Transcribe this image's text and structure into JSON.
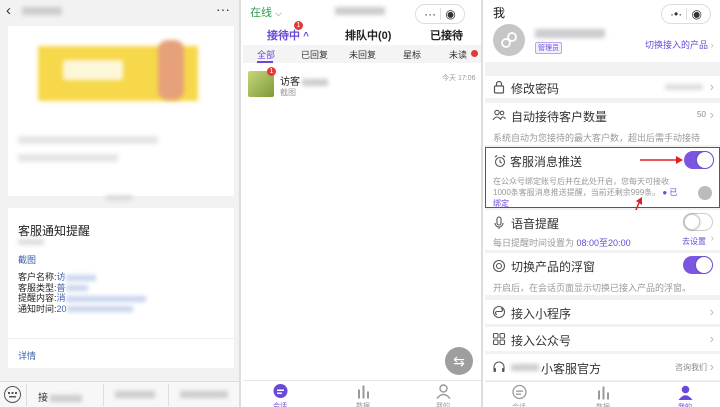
{
  "panel1": {
    "card_title": "客服通知提醒",
    "link_screenshot": "截图",
    "fields": [
      {
        "label": "客户名称:",
        "value": "访"
      },
      {
        "label": "客服类型:",
        "value": "普"
      },
      {
        "label": "提醒内容:",
        "value": "消"
      },
      {
        "label": "通知时间:",
        "value": "20"
      }
    ],
    "detail_link": "详情",
    "menu_icon": "keyboard-icon",
    "menu_first": "接"
  },
  "panel2": {
    "status": "在线",
    "tabs": [
      {
        "label": "接待中",
        "badge": "1"
      },
      {
        "label": "排队中(0)"
      },
      {
        "label": "已接待"
      }
    ],
    "filters": [
      "全部",
      "已回复",
      "未回复",
      "星标",
      "未读"
    ],
    "conversation": {
      "name": "访客",
      "time": "今天 17:06",
      "preview": "截图",
      "badge": "1"
    },
    "bottom_tabs": [
      {
        "label": "会话",
        "icon": "chat-icon"
      },
      {
        "label": "数据",
        "icon": "bar-chart-icon"
      },
      {
        "label": "我的",
        "icon": "user-icon"
      }
    ]
  },
  "panel3": {
    "title": "我",
    "role_badge": "管理员",
    "switch_product": "切换接入的产品",
    "rows": {
      "password": "修改密码",
      "auto_count": "自动接待客户数量",
      "auto_count_value": "50",
      "auto_count_desc": "系统自动为您接待的最大客户数，超出后需手动接待",
      "push": "客服消息推送",
      "push_desc": "在公众号绑定账号后并在此处开启，您每天可接收1000条客服消息推送提醒，当前还剩余999条。",
      "bound": "已绑定",
      "voice": "语音提醒",
      "voice_desc_prefix": "每日提醒时间设置为",
      "voice_time": "08:00至20:00",
      "voice_set": "去设置",
      "float": "切换产品的浮窗",
      "float_desc": "开启后，在会话页面显示切换已接入产品的浮窗。",
      "mini": "接入小程序",
      "official": "接入公众号",
      "service": "小客服官方",
      "contact": "咨询我们"
    },
    "toggles": {
      "push": true,
      "voice": false,
      "float": true
    },
    "accent_color": "#7b56e0",
    "highlight_color": "#e02020"
  }
}
